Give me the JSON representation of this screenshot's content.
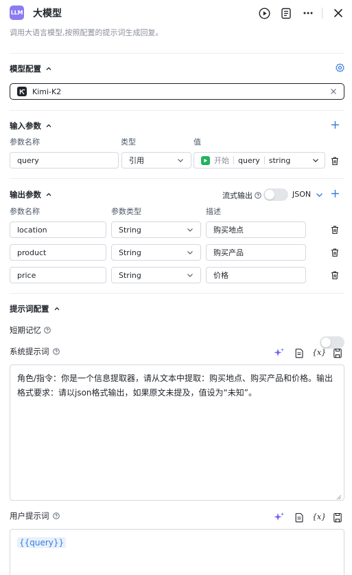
{
  "header": {
    "badge": "LLM",
    "title": "大模型",
    "subtitle": "调用大语言模型,按照配置的提示词生成回复。"
  },
  "model_config": {
    "title": "模型配置",
    "selected_model": "Kimi-K2"
  },
  "input_params": {
    "title": "输入参数",
    "col_name": "参数名称",
    "col_type": "类型",
    "col_value": "值",
    "rows": [
      {
        "name": "query",
        "type": "引用",
        "source": "开始",
        "var": "query",
        "var_type": "string"
      }
    ]
  },
  "output_params": {
    "title": "输出参数",
    "stream_label": "流式输出",
    "format": "JSON",
    "col_name": "参数名称",
    "col_type": "参数类型",
    "col_desc": "描述",
    "rows": [
      {
        "name": "location",
        "type": "String",
        "desc": "购买地点"
      },
      {
        "name": "product",
        "type": "String",
        "desc": "购买产品"
      },
      {
        "name": "price",
        "type": "String",
        "desc": "价格"
      }
    ]
  },
  "prompt_config": {
    "title": "提示词配置",
    "memory_label": "短期记忆",
    "system_label": "系统提示词",
    "system_text": "角色/指令：你是一个信息提取器，请从文本中提取：购买地点、购买产品和价格。输出格式要求：请以json格式输出，如果原文未提及，值设为“未知”。",
    "user_label": "用户提示词",
    "user_var": "{{query}}",
    "var_tool": "{x}"
  },
  "colors": {
    "accent": "#3b7bdc",
    "badge": "#8b7cf0",
    "play": "#22b35e",
    "sparkle": "#7b5cf5"
  }
}
